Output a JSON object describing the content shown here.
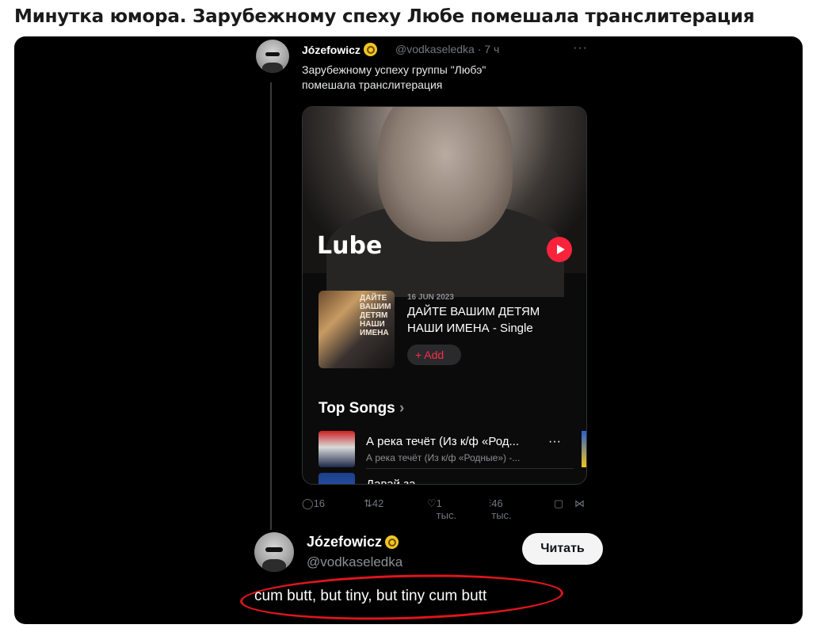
{
  "post": {
    "title": "Минутка юмора. Зарубежному спеху Любе помешала транслитерация"
  },
  "tweet": {
    "author": "Józefowicz",
    "handle": "@vodkaseledka · 7 ч",
    "more": "···",
    "text": "Зарубежному успеху группы \"Любэ\" помешала транслитерация"
  },
  "music_card": {
    "artist": "Lube",
    "album_date": "16 JUN 2023",
    "album_title": "ДАЙТЕ ВАШИМ ДЕТЯМ НАШИ ИМЕНА - Single",
    "album_cover_text": "ДАЙТЕ ВАШИМ ДЕТЯМ НАШИ ИМЕНА",
    "add_label": "+ Add",
    "top_songs_label": "Top Songs",
    "songs": [
      {
        "title": "А река течёт (Из к/ф «Род...",
        "subtitle": "А река течёт (Из к/ф «Родные») -...",
        "more": "···"
      },
      {
        "title": "Давай за"
      }
    ]
  },
  "actions": {
    "replies": "16",
    "reposts": "42",
    "likes": "1 тыс.",
    "views": "46 тыс."
  },
  "reply": {
    "author": "Józefowicz",
    "handle": "@vodkaseledka",
    "read_label": "Читать",
    "text": "cum butt, but tiny, but tiny cum butt"
  },
  "colors": {
    "accent_red": "#fa233b",
    "circle_red": "#e0151d"
  }
}
